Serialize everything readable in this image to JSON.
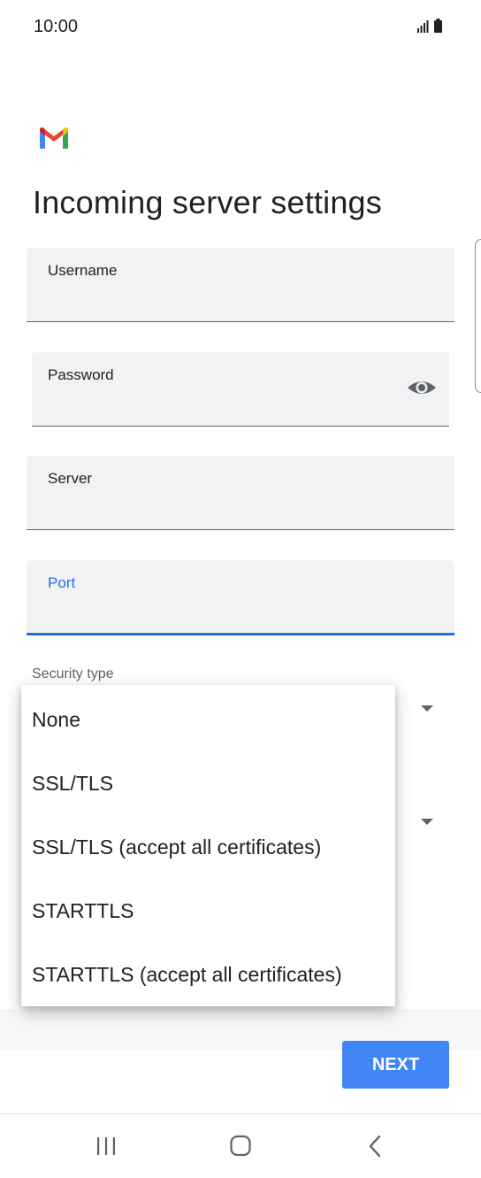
{
  "status_bar": {
    "time": "10:00"
  },
  "page": {
    "title": "Incoming server settings"
  },
  "fields": {
    "username": {
      "label": "Username",
      "value": ""
    },
    "password": {
      "label": "Password",
      "value": ""
    },
    "server": {
      "label": "Server",
      "value": ""
    },
    "port": {
      "label": "Port",
      "value": ""
    }
  },
  "security": {
    "label": "Security type",
    "options": [
      "None",
      "SSL/TLS",
      "SSL/TLS (accept all certificates)",
      "STARTTLS",
      "STARTTLS (accept all certificates)"
    ]
  },
  "actions": {
    "next_label": "NEXT"
  },
  "colors": {
    "accent": "#1a73e8",
    "button": "#4285f4",
    "field_bg": "#f1f2f4"
  },
  "icons": [
    "signal-icon",
    "battery-icon",
    "gmail-logo-icon",
    "visibility-icon",
    "dropdown-arrow-icon",
    "recent-apps-icon",
    "home-icon",
    "back-icon"
  ]
}
